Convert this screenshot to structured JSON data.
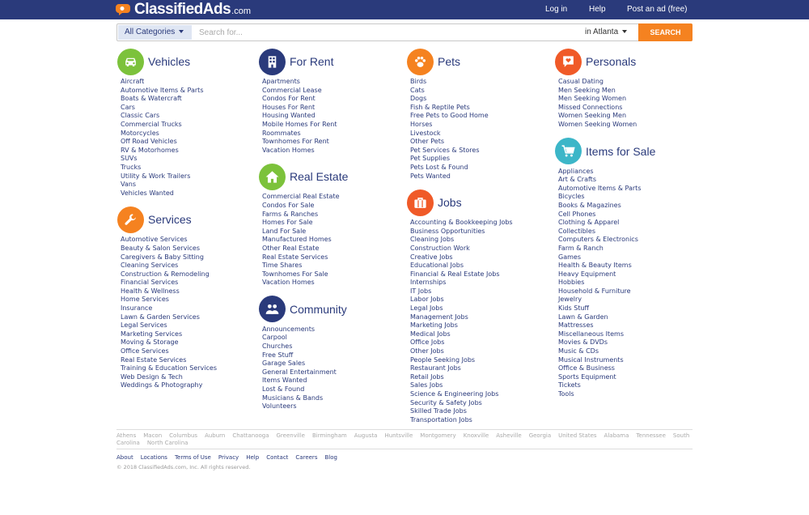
{
  "brand": {
    "name": "ClassifiedAds",
    "tld": ".com"
  },
  "topnav": {
    "login": "Log in",
    "help": "Help",
    "post": "Post an ad (free)"
  },
  "search": {
    "category": "All Categories",
    "placeholder": "Search for...",
    "location": "in Atlanta",
    "button": "SEARCH"
  },
  "colors": {
    "navy": "#2a3a7b",
    "orange": "#f58220",
    "green": "#7cc23b",
    "teal": "#3cb6c8",
    "redorange": "#f05a28"
  },
  "columns": [
    [
      {
        "key": "vehicles",
        "title": "Vehicles",
        "icon": "car-icon",
        "color": "#7cc23b",
        "items": [
          "Aircraft",
          "Automotive Items & Parts",
          "Boats & Watercraft",
          "Cars",
          "Classic Cars",
          "Commercial Trucks",
          "Motorcycles",
          "Off Road Vehicles",
          "RV & Motorhomes",
          "SUVs",
          "Trucks",
          "Utility & Work Trailers",
          "Vans",
          "Vehicles Wanted"
        ]
      },
      {
        "key": "services",
        "title": "Services",
        "icon": "wrench-icon",
        "color": "#f58220",
        "items": [
          "Automotive Services",
          "Beauty & Salon Services",
          "Caregivers & Baby Sitting",
          "Cleaning Services",
          "Construction & Remodeling",
          "Financial Services",
          "Health & Wellness",
          "Home Services",
          "Insurance",
          "Lawn & Garden Services",
          "Legal Services",
          "Marketing Services",
          "Moving & Storage",
          "Office Services",
          "Real Estate Services",
          "Training & Education Services",
          "Web Design & Tech",
          "Weddings & Photography"
        ]
      }
    ],
    [
      {
        "key": "forrent",
        "title": "For Rent",
        "icon": "building-icon",
        "color": "#2a3a7b",
        "items": [
          "Apartments",
          "Commercial Lease",
          "Condos For Rent",
          "Houses For Rent",
          "Housing Wanted",
          "Mobile Homes For Rent",
          "Roommates",
          "Townhomes For Rent",
          "Vacation Homes"
        ]
      },
      {
        "key": "realestate",
        "title": "Real Estate",
        "icon": "house-icon",
        "color": "#7cc23b",
        "items": [
          "Commercial Real Estate",
          "Condos For Sale",
          "Farms & Ranches",
          "Homes For Sale",
          "Land For Sale",
          "Manufactured Homes",
          "Other Real Estate",
          "Real Estate Services",
          "Time Shares",
          "Townhomes For Sale",
          "Vacation Homes"
        ]
      },
      {
        "key": "community",
        "title": "Community",
        "icon": "people-icon",
        "color": "#2a3a7b",
        "items": [
          "Announcements",
          "Carpool",
          "Churches",
          "Free Stuff",
          "Garage Sales",
          "General Entertainment",
          "Items Wanted",
          "Lost & Found",
          "Musicians & Bands",
          "Volunteers"
        ]
      }
    ],
    [
      {
        "key": "pets",
        "title": "Pets",
        "icon": "paw-icon",
        "color": "#f58220",
        "items": [
          "Birds",
          "Cats",
          "Dogs",
          "Fish & Reptile Pets",
          "Free Pets to Good Home",
          "Horses",
          "Livestock",
          "Other Pets",
          "Pet Services & Stores",
          "Pet Supplies",
          "Pets Lost & Found",
          "Pets Wanted"
        ]
      },
      {
        "key": "jobs",
        "title": "Jobs",
        "icon": "briefcase-icon",
        "color": "#f05a28",
        "items": [
          "Accounting & Bookkeeping Jobs",
          "Business Opportunities",
          "Cleaning Jobs",
          "Construction Work",
          "Creative Jobs",
          "Educational Jobs",
          "Financial & Real Estate Jobs",
          "Internships",
          "IT Jobs",
          "Labor Jobs",
          "Legal Jobs",
          "Management Jobs",
          "Marketing Jobs",
          "Medical Jobs",
          "Office Jobs",
          "Other Jobs",
          "People Seeking Jobs",
          "Restaurant Jobs",
          "Retail Jobs",
          "Sales Jobs",
          "Science & Engineering Jobs",
          "Security & Safety Jobs",
          "Skilled Trade Jobs",
          "Transportation Jobs"
        ]
      }
    ],
    [
      {
        "key": "personals",
        "title": "Personals",
        "icon": "heart-chat-icon",
        "color": "#f05a28",
        "items": [
          "Casual Dating",
          "Men Seeking Men",
          "Men Seeking Women",
          "Missed Connections",
          "Women Seeking Men",
          "Women Seeking Women"
        ]
      },
      {
        "key": "forsale",
        "title": "Items for Sale",
        "icon": "cart-icon",
        "color": "#3cb6c8",
        "items": [
          "Appliances",
          "Art & Crafts",
          "Automotive Items & Parts",
          "Bicycles",
          "Books & Magazines",
          "Cell Phones",
          "Clothing & Apparel",
          "Collectibles",
          "Computers & Electronics",
          "Farm & Ranch",
          "Games",
          "Health & Beauty Items",
          "Heavy Equipment",
          "Hobbies",
          "Household & Furniture",
          "Jewelry",
          "Kids Stuff",
          "Lawn & Garden",
          "Mattresses",
          "Miscellaneous Items",
          "Movies & DVDs",
          "Music & CDs",
          "Musical Instruments",
          "Office & Business",
          "Sports Equipment",
          "Tickets",
          "Tools"
        ]
      }
    ]
  ],
  "cities": [
    "Athens",
    "Macon",
    "Columbus",
    "Auburn",
    "Chattanooga",
    "Greenville",
    "Birmingham",
    "Augusta",
    "Huntsville",
    "Montgomery",
    "Knoxville",
    "Asheville",
    "Georgia",
    "United States",
    "Alabama",
    "Tennessee",
    "South Carolina",
    "North Carolina"
  ],
  "footer": {
    "links": [
      "About",
      "Locations",
      "Terms of Use",
      "Privacy",
      "Help",
      "Contact",
      "Careers",
      "Blog"
    ],
    "copyright": "© 2018 ClassifiedAds.com, Inc. All rights reserved."
  }
}
